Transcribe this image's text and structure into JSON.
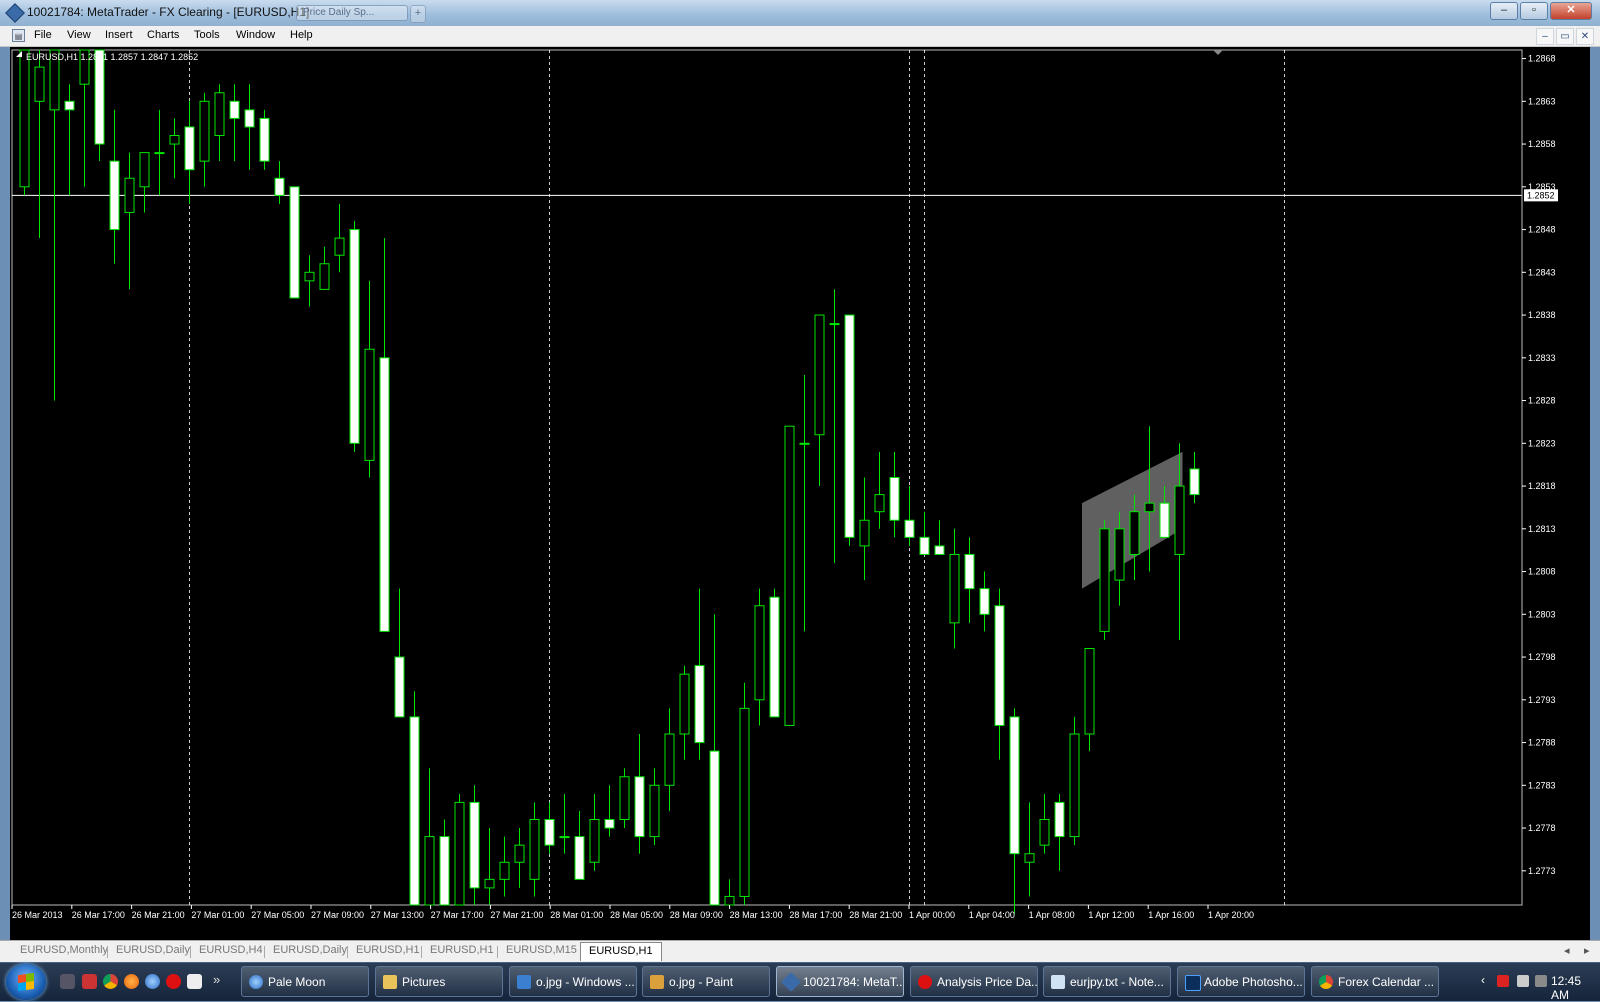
{
  "window": {
    "title": "10021784: MetaTrader - FX Clearing - [EURUSD,H1]",
    "ghost_tab": "Price Daily Sp..."
  },
  "window_controls": {
    "minimize": "–",
    "maximize": "▫",
    "close": "✕"
  },
  "mdi_controls": {
    "minimize": "–",
    "restore": "▭",
    "close": "✕"
  },
  "menu": [
    "File",
    "View",
    "Insert",
    "Charts",
    "Tools",
    "Window",
    "Help"
  ],
  "chart_tabs": {
    "items": [
      "EURUSD,Monthly",
      "EURUSD,Daily",
      "EURUSD,H4",
      "EURUSD,Daily",
      "EURUSD,H1",
      "EURUSD,H1",
      "EURUSD,M15",
      "EURUSD,H1"
    ],
    "active_index": 7,
    "scroll_left": "◂",
    "scroll_right": "▸"
  },
  "taskbar": {
    "quicklaunch_more": "»",
    "tasks": [
      "Pale Moon",
      "Pictures",
      "o.jpg - Windows ...",
      "o.jpg - Paint",
      "10021784: MetaT...",
      "Analysis Price Da...",
      "eurjpy.txt - Note...",
      "Adobe Photosho...",
      "Forex Calendar ..."
    ],
    "active_task": 4,
    "tray_chevron": "‹",
    "clock": "12:45 AM"
  },
  "colors": {
    "background": "#000000",
    "candle_up": "#000000",
    "candle_down": "#ffffff",
    "wick": "#00e600",
    "grid": "#ffffff",
    "axis_text": "#ffffff",
    "channel": "#808080"
  },
  "chart_data": {
    "type": "candlestick",
    "symbol_info": "EURUSD,H1  1.2851 1.2857 1.2847 1.2852",
    "current_price": 1.2852,
    "current_price_label": "1.2852",
    "ylim": [
      1.2769,
      1.2869
    ],
    "y_ticks": [
      "1.2868",
      "1.2863",
      "1.2858",
      "1.2853",
      "1.2848",
      "1.2843",
      "1.2838",
      "1.2833",
      "1.2828",
      "1.2823",
      "1.2818",
      "1.2813",
      "1.2808",
      "1.2803",
      "1.2798",
      "1.2793",
      "1.2788",
      "1.2783",
      "1.2778",
      "1.2773"
    ],
    "x_ticks": [
      "26 Mar 2013",
      "26 Mar 17:00",
      "26 Mar 21:00",
      "27 Mar 01:00",
      "27 Mar 05:00",
      "27 Mar 09:00",
      "27 Mar 13:00",
      "27 Mar 17:00",
      "27 Mar 21:00",
      "28 Mar 01:00",
      "28 Mar 05:00",
      "28 Mar 09:00",
      "28 Mar 13:00",
      "28 Mar 17:00",
      "28 Mar 21:00",
      "1 Apr 00:00",
      "1 Apr 04:00",
      "1 Apr 08:00",
      "1 Apr 12:00",
      "1 Apr 16:00",
      "1 Apr 20:00"
    ],
    "period_separators": [
      11,
      35,
      59,
      60,
      84
    ],
    "candles": [
      {
        "o": 1.2853,
        "h": 1.2869,
        "l": 1.2852,
        "c": 1.2869
      },
      {
        "o": 1.2863,
        "h": 1.2869,
        "l": 1.2847,
        "c": 1.2867
      },
      {
        "o": 1.2862,
        "h": 1.2869,
        "l": 1.2828,
        "c": 1.2869
      },
      {
        "o": 1.2863,
        "h": 1.2865,
        "l": 1.2852,
        "c": 1.2862
      },
      {
        "o": 1.2865,
        "h": 1.2869,
        "l": 1.2853,
        "c": 1.2869
      },
      {
        "o": 1.2869,
        "h": 1.2869,
        "l": 1.2856,
        "c": 1.2858
      },
      {
        "o": 1.2856,
        "h": 1.2862,
        "l": 1.2844,
        "c": 1.2848
      },
      {
        "o": 1.285,
        "h": 1.2857,
        "l": 1.2841,
        "c": 1.2854
      },
      {
        "o": 1.2853,
        "h": 1.2856,
        "l": 1.285,
        "c": 1.2857
      },
      {
        "o": 1.2857,
        "h": 1.2862,
        "l": 1.2852,
        "c": 1.2857
      },
      {
        "o": 1.2858,
        "h": 1.2861,
        "l": 1.2854,
        "c": 1.2859
      },
      {
        "o": 1.286,
        "h": 1.2863,
        "l": 1.2851,
        "c": 1.2855
      },
      {
        "o": 1.2856,
        "h": 1.2864,
        "l": 1.2853,
        "c": 1.2863
      },
      {
        "o": 1.2859,
        "h": 1.2865,
        "l": 1.2856,
        "c": 1.2864
      },
      {
        "o": 1.2863,
        "h": 1.2865,
        "l": 1.2856,
        "c": 1.2861
      },
      {
        "o": 1.2862,
        "h": 1.2865,
        "l": 1.2855,
        "c": 1.286
      },
      {
        "o": 1.2861,
        "h": 1.2862,
        "l": 1.2855,
        "c": 1.2856
      },
      {
        "o": 1.2854,
        "h": 1.2856,
        "l": 1.2851,
        "c": 1.2852
      },
      {
        "o": 1.2853,
        "h": 1.2853,
        "l": 1.284,
        "c": 1.284
      },
      {
        "o": 1.2842,
        "h": 1.2845,
        "l": 1.2839,
        "c": 1.2843
      },
      {
        "o": 1.2841,
        "h": 1.2846,
        "l": 1.2841,
        "c": 1.2844
      },
      {
        "o": 1.2845,
        "h": 1.2851,
        "l": 1.2843,
        "c": 1.2847
      },
      {
        "o": 1.2848,
        "h": 1.2849,
        "l": 1.2822,
        "c": 1.2823
      },
      {
        "o": 1.2821,
        "h": 1.2842,
        "l": 1.2819,
        "c": 1.2834
      },
      {
        "o": 1.2833,
        "h": 1.2847,
        "l": 1.2831,
        "c": 1.2801
      },
      {
        "o": 1.2798,
        "h": 1.2806,
        "l": 1.2793,
        "c": 1.2791
      },
      {
        "o": 1.2791,
        "h": 1.2794,
        "l": 1.2769,
        "c": 1.2769
      },
      {
        "o": 1.2769,
        "h": 1.2785,
        "l": 1.2769,
        "c": 1.2777
      },
      {
        "o": 1.2777,
        "h": 1.2779,
        "l": 1.2769,
        "c": 1.2769
      },
      {
        "o": 1.2769,
        "h": 1.2782,
        "l": 1.2769,
        "c": 1.2781
      },
      {
        "o": 1.2781,
        "h": 1.2783,
        "l": 1.2769,
        "c": 1.2771
      },
      {
        "o": 1.2771,
        "h": 1.2778,
        "l": 1.2769,
        "c": 1.2772
      },
      {
        "o": 1.2772,
        "h": 1.2777,
        "l": 1.277,
        "c": 1.2774
      },
      {
        "o": 1.2774,
        "h": 1.2778,
        "l": 1.2771,
        "c": 1.2776
      },
      {
        "o": 1.2772,
        "h": 1.2781,
        "l": 1.277,
        "c": 1.2779
      },
      {
        "o": 1.2779,
        "h": 1.2781,
        "l": 1.2775,
        "c": 1.2776
      },
      {
        "o": 1.2777,
        "h": 1.2782,
        "l": 1.2775,
        "c": 1.2777
      },
      {
        "o": 1.2777,
        "h": 1.278,
        "l": 1.2773,
        "c": 1.2772
      },
      {
        "o": 1.2774,
        "h": 1.2782,
        "l": 1.2773,
        "c": 1.2779
      },
      {
        "o": 1.2779,
        "h": 1.2783,
        "l": 1.2777,
        "c": 1.2778
      },
      {
        "o": 1.2779,
        "h": 1.2785,
        "l": 1.2778,
        "c": 1.2784
      },
      {
        "o": 1.2784,
        "h": 1.2789,
        "l": 1.2775,
        "c": 1.2777
      },
      {
        "o": 1.2777,
        "h": 1.2785,
        "l": 1.2776,
        "c": 1.2783
      },
      {
        "o": 1.2783,
        "h": 1.2792,
        "l": 1.278,
        "c": 1.2789
      },
      {
        "o": 1.2789,
        "h": 1.2797,
        "l": 1.2786,
        "c": 1.2796
      },
      {
        "o": 1.2797,
        "h": 1.2806,
        "l": 1.2786,
        "c": 1.2788
      },
      {
        "o": 1.2787,
        "h": 1.2803,
        "l": 1.2769,
        "c": 1.2769
      },
      {
        "o": 1.2769,
        "h": 1.2772,
        "l": 1.2769,
        "c": 1.277
      },
      {
        "o": 1.277,
        "h": 1.2795,
        "l": 1.2769,
        "c": 1.2792
      },
      {
        "o": 1.2793,
        "h": 1.2806,
        "l": 1.279,
        "c": 1.2804
      },
      {
        "o": 1.2805,
        "h": 1.2806,
        "l": 1.2791,
        "c": 1.2791
      },
      {
        "o": 1.279,
        "h": 1.282,
        "l": 1.279,
        "c": 1.2825
      },
      {
        "o": 1.2823,
        "h": 1.2831,
        "l": 1.2801,
        "c": 1.2823
      },
      {
        "o": 1.2824,
        "h": 1.2838,
        "l": 1.2818,
        "c": 1.2838
      },
      {
        "o": 1.2837,
        "h": 1.2841,
        "l": 1.2809,
        "c": 1.2837
      },
      {
        "o": 1.2838,
        "h": 1.2838,
        "l": 1.2811,
        "c": 1.2812
      },
      {
        "o": 1.2811,
        "h": 1.2819,
        "l": 1.2807,
        "c": 1.2814
      },
      {
        "o": 1.2815,
        "h": 1.2822,
        "l": 1.2813,
        "c": 1.2817
      },
      {
        "o": 1.2819,
        "h": 1.2822,
        "l": 1.2812,
        "c": 1.2814
      },
      {
        "o": 1.2814,
        "h": 1.2818,
        "l": 1.2811,
        "c": 1.2812
      },
      {
        "o": 1.2812,
        "h": 1.2815,
        "l": 1.281,
        "c": 1.281
      },
      {
        "o": 1.2811,
        "h": 1.2814,
        "l": 1.281,
        "c": 1.281
      },
      {
        "o": 1.2802,
        "h": 1.2813,
        "l": 1.2799,
        "c": 1.281
      },
      {
        "o": 1.281,
        "h": 1.2812,
        "l": 1.2802,
        "c": 1.2806
      },
      {
        "o": 1.2806,
        "h": 1.2808,
        "l": 1.2801,
        "c": 1.2803
      },
      {
        "o": 1.2804,
        "h": 1.2806,
        "l": 1.2786,
        "c": 1.279
      },
      {
        "o": 1.2791,
        "h": 1.2792,
        "l": 1.2768,
        "c": 1.2775
      },
      {
        "o": 1.2774,
        "h": 1.2781,
        "l": 1.277,
        "c": 1.2775
      },
      {
        "o": 1.2776,
        "h": 1.2782,
        "l": 1.2775,
        "c": 1.2779
      },
      {
        "o": 1.2781,
        "h": 1.2782,
        "l": 1.2773,
        "c": 1.2777
      },
      {
        "o": 1.2777,
        "h": 1.2791,
        "l": 1.2776,
        "c": 1.2789
      },
      {
        "o": 1.2789,
        "h": 1.2799,
        "l": 1.2787,
        "c": 1.2799
      },
      {
        "o": 1.2801,
        "h": 1.2814,
        "l": 1.28,
        "c": 1.2813
      },
      {
        "o": 1.2807,
        "h": 1.2815,
        "l": 1.2804,
        "c": 1.2813
      },
      {
        "o": 1.281,
        "h": 1.2817,
        "l": 1.2807,
        "c": 1.2815
      },
      {
        "o": 1.2815,
        "h": 1.2825,
        "l": 1.2808,
        "c": 1.2816
      },
      {
        "o": 1.2816,
        "h": 1.2818,
        "l": 1.2812,
        "c": 1.2812
      },
      {
        "o": 1.281,
        "h": 1.2823,
        "l": 1.28,
        "c": 1.2818
      },
      {
        "o": 1.282,
        "h": 1.2822,
        "l": 1.2816,
        "c": 1.2817
      }
    ],
    "channel": {
      "x1": 70.5,
      "y1_low": 1.2806,
      "y1_high": 1.2816,
      "x2": 77.2,
      "y2_low": 1.2813,
      "y2_high": 1.2822
    },
    "grid": false,
    "legend": "none"
  }
}
